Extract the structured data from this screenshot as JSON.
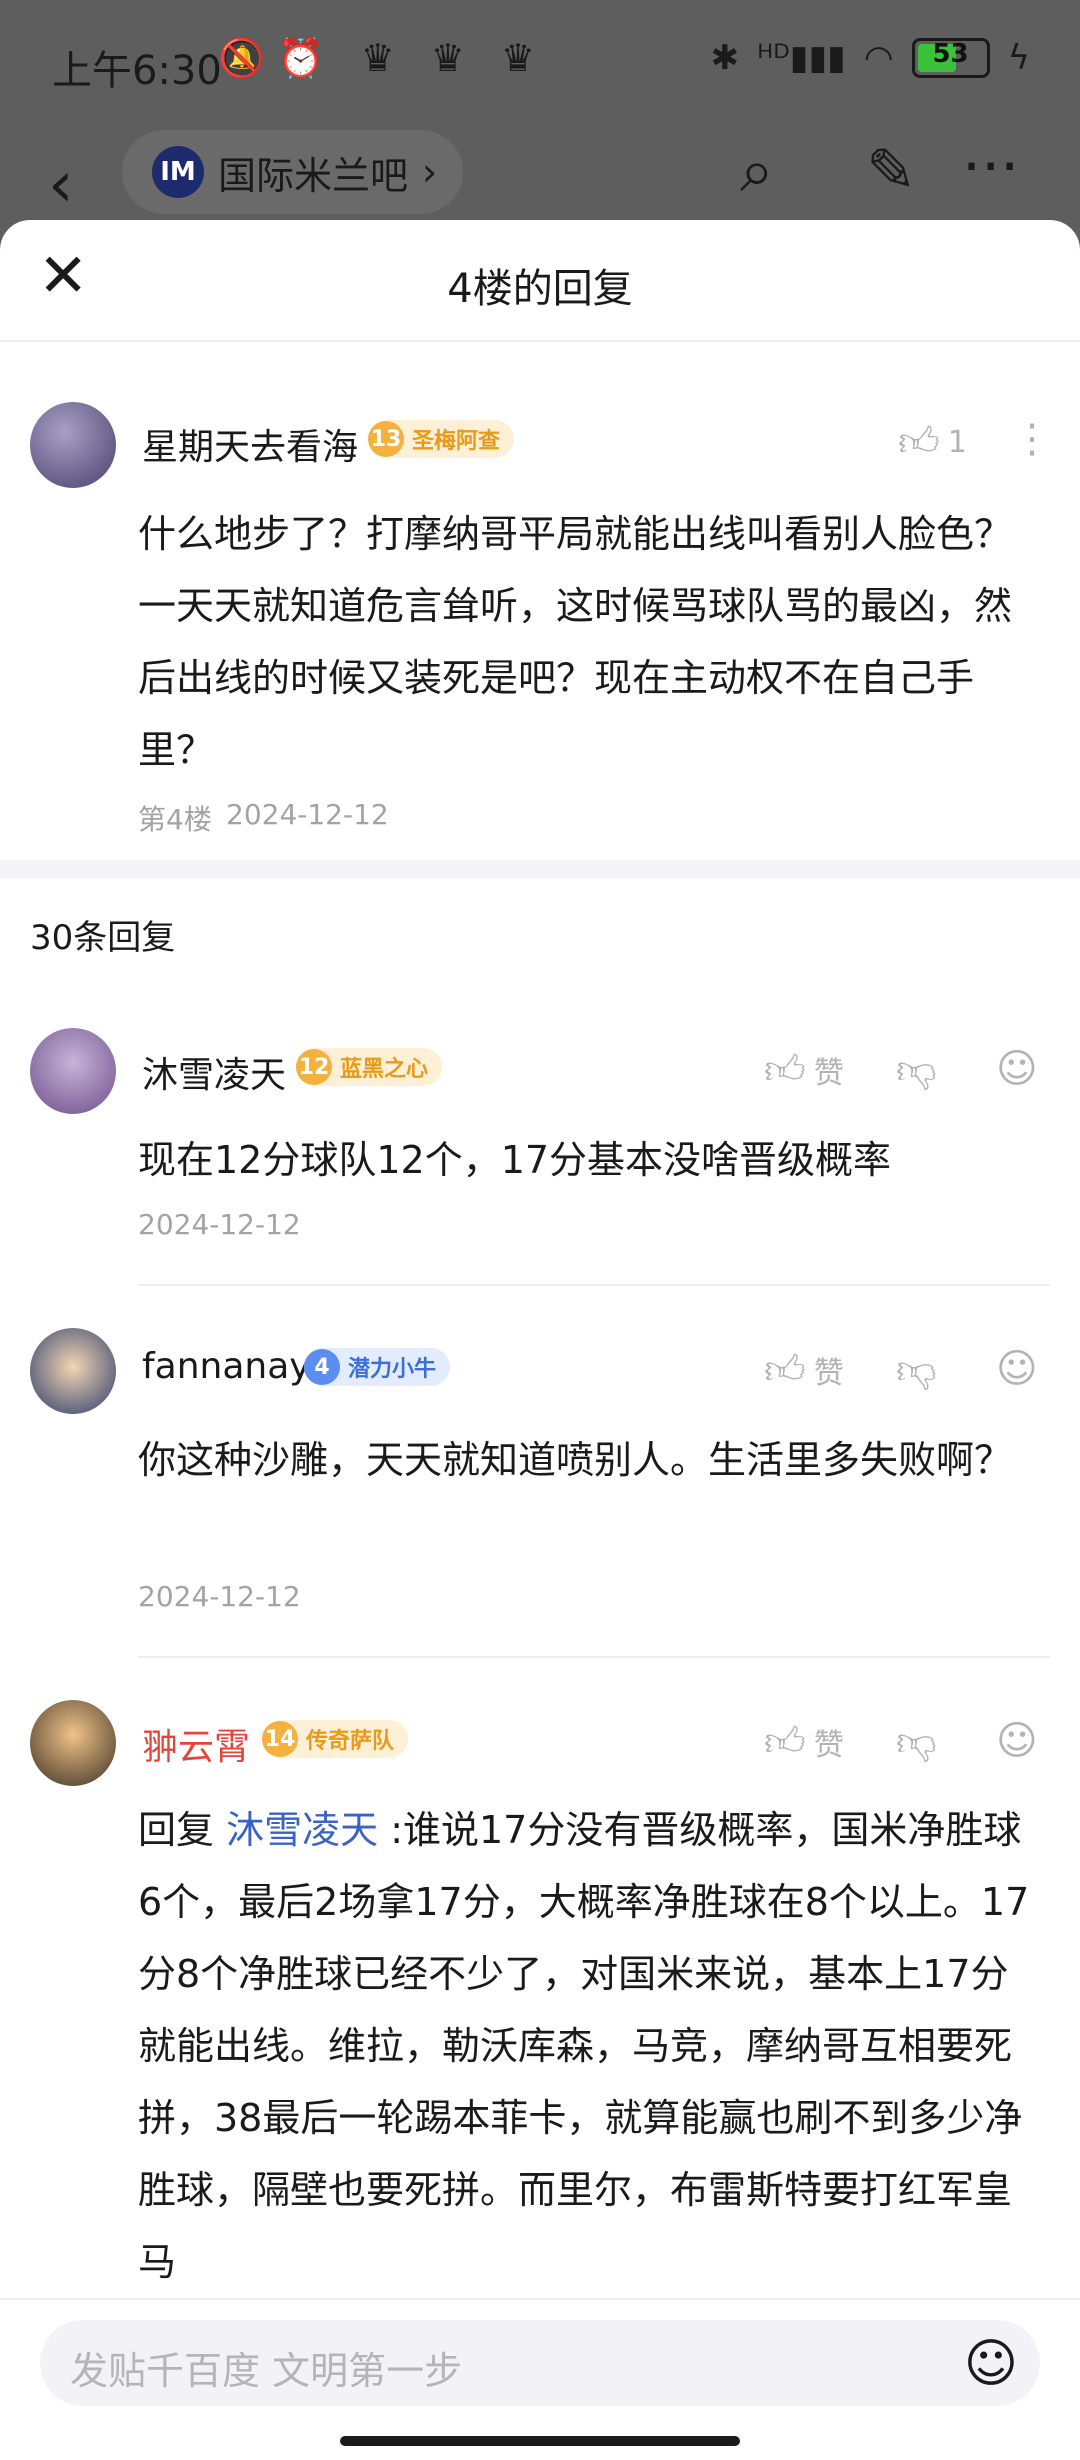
{
  "status": {
    "time": "上午6:30",
    "icons_left": "🔕⏰ ♛ ♛ ♛",
    "signal": "ᴴᴰ▮▮▮",
    "battery": "53"
  },
  "nav": {
    "forum": "国际米兰吧",
    "back": "‹",
    "search": "⌕",
    "edit": "✎",
    "more": "···"
  },
  "sheet": {
    "title": "4楼的回复",
    "close": "✕"
  },
  "op": {
    "name": "星期天去看海",
    "badge_level": "13",
    "badge_text": "圣梅阿查",
    "likes": "1",
    "content": "什么地步了？打摩纳哥平局就能出线叫看别人脸色？一天天就知道危言耸听，这时候骂球队骂的最凶，然后出线的时候又装死是吧？现在主动权不在自己手里？",
    "floor": "第4楼",
    "date": "2024-12-12"
  },
  "reply_count": "30条回复",
  "replies": [
    {
      "name": "沐雪凌天",
      "badge_level": "12",
      "badge_text": "蓝黑之心",
      "like_label": "赞",
      "content": "现在12分球队12个，17分基本没啥晋级概率",
      "date": "2024-12-12"
    },
    {
      "name": "fannanay",
      "badge_level": "4",
      "badge_text": "潜力小牛",
      "like_label": "赞",
      "content": "你这种沙雕，天天就知道喷别人。生活里多失败啊？",
      "date": "2024-12-12"
    },
    {
      "name": "翀云霄",
      "badge_level": "14",
      "badge_text": "传奇萨队",
      "like_label": "赞",
      "reply_prefix": "回复",
      "mention": "沐雪凌天",
      "content": " :谁说17分没有晋级概率，国米净胜球6个，最后2场拿17分，大概率净胜球在8个以上。17分8个净胜球已经不少了，对国米来说，基本上17分就能出线。维拉，勒沃库森，马竞，摩纳哥互相要死拼，38最后一轮踢本菲卡，就算能赢也刷不到多少净胜球，隔壁也要死拼。而里尔，布雷斯特要打红军皇马"
    }
  ],
  "composer": {
    "placeholder": "发贴千百度 文明第一步"
  },
  "colors": {
    "accent_gold": "#f4b13d",
    "accent_blue": "#5b8ef0",
    "mention": "#3a62c4",
    "red_name": "#e2463a"
  }
}
